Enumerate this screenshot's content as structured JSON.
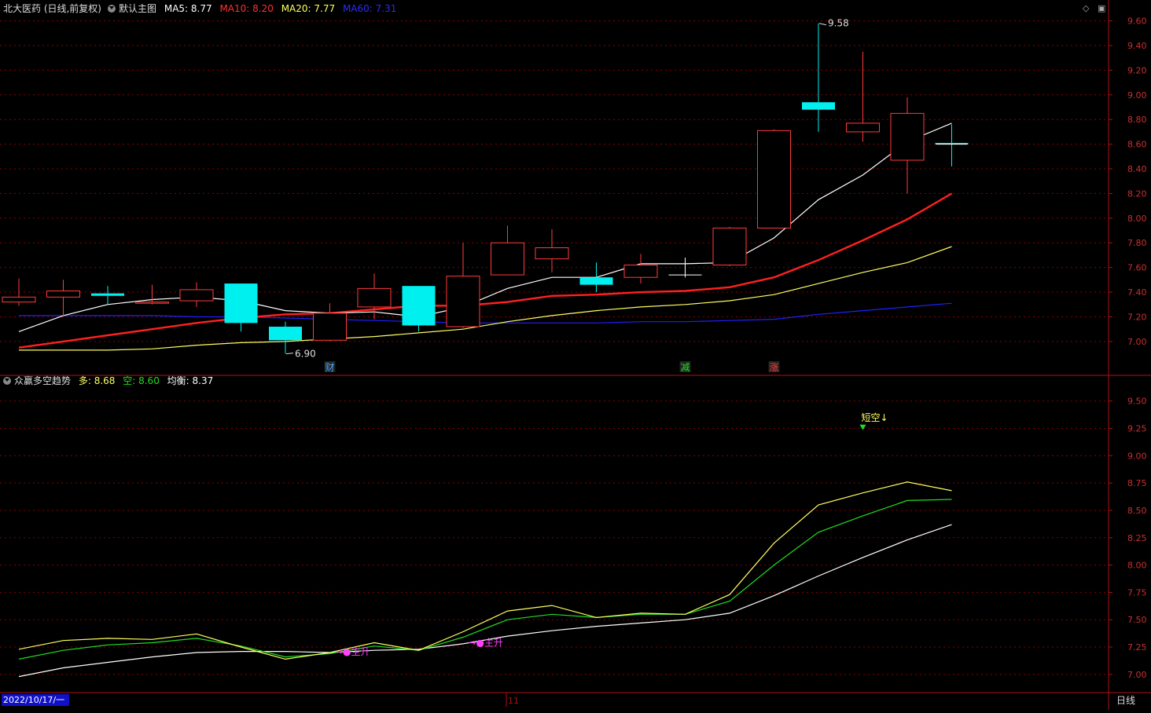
{
  "header_main": {
    "stock": "北大医药 (日线,前复权)",
    "main_chart": "默认主图",
    "ma5": "MA5: 8.77",
    "ma10": "MA10: 8.20",
    "ma20": "MA20: 7.77",
    "ma60": "MA60: 7.31"
  },
  "header_sub": {
    "indicator": "众赢多空趋势",
    "duo": "多: 8.68",
    "kong": "空: 8.60",
    "junheng": "均衡: 8.37"
  },
  "footer": {
    "date": "2022/10/17/一",
    "month_mark": "11",
    "period": "日线"
  },
  "colors": {
    "up": "#ff3b3b",
    "down": "#00f0f0",
    "ma5": "#ffffff",
    "ma10": "#ff2020",
    "ma20": "#ffff60",
    "ma60": "#2020ff",
    "duo": "#ffff60",
    "kong": "#20dd20",
    "junheng": "#ffffff",
    "grid": "#8b0000",
    "axis": "#b01010",
    "signal": "#ff40ff"
  },
  "chart_data": [
    {
      "type": "candlestick",
      "name": "main",
      "ylim": [
        6.84,
        9.68
      ],
      "yticks": [
        7.0,
        7.2,
        7.4,
        7.6,
        7.8,
        8.0,
        8.2,
        8.4,
        8.6,
        8.8,
        9.0,
        9.2,
        9.4,
        9.6
      ],
      "candles": [
        {
          "o": 7.32,
          "h": 7.51,
          "l": 7.29,
          "c": 7.36
        },
        {
          "o": 7.36,
          "h": 7.5,
          "l": 7.2,
          "c": 7.41
        },
        {
          "o": 7.39,
          "h": 7.45,
          "l": 7.3,
          "c": 7.37
        },
        {
          "o": 7.31,
          "h": 7.46,
          "l": 7.3,
          "c": 7.32
        },
        {
          "o": 7.33,
          "h": 7.48,
          "l": 7.28,
          "c": 7.42
        },
        {
          "o": 7.47,
          "h": 7.47,
          "l": 7.08,
          "c": 7.15
        },
        {
          "o": 7.12,
          "h": 7.16,
          "l": 6.9,
          "c": 7.01
        },
        {
          "o": 7.01,
          "h": 7.31,
          "l": 7.0,
          "c": 7.23
        },
        {
          "o": 7.28,
          "h": 7.55,
          "l": 7.18,
          "c": 7.43
        },
        {
          "o": 7.45,
          "h": 7.45,
          "l": 7.08,
          "c": 7.13
        },
        {
          "o": 7.12,
          "h": 7.8,
          "l": 7.11,
          "c": 7.53
        },
        {
          "o": 7.54,
          "h": 7.94,
          "l": 7.54,
          "c": 7.8
        },
        {
          "o": 7.67,
          "h": 7.91,
          "l": 7.56,
          "c": 7.76
        },
        {
          "o": 7.52,
          "h": 7.64,
          "l": 7.4,
          "c": 7.46
        },
        {
          "o": 7.52,
          "h": 7.71,
          "l": 7.47,
          "c": 7.62
        },
        {
          "o": 7.54,
          "h": 7.68,
          "l": 7.52,
          "c": 7.54
        },
        {
          "o": 7.62,
          "h": 7.93,
          "l": 7.61,
          "c": 7.92
        },
        {
          "o": 7.92,
          "h": 8.72,
          "l": 7.92,
          "c": 8.71
        },
        {
          "o": 8.94,
          "h": 9.58,
          "l": 8.7,
          "c": 8.88
        },
        {
          "o": 8.7,
          "h": 9.35,
          "l": 8.62,
          "c": 8.77
        },
        {
          "o": 8.47,
          "h": 8.98,
          "l": 8.2,
          "c": 8.85
        },
        {
          "o": 8.61,
          "h": 8.76,
          "l": 8.42,
          "c": 8.6
        }
      ],
      "ma5": [
        7.08,
        7.21,
        7.3,
        7.34,
        7.36,
        7.33,
        7.25,
        7.23,
        7.24,
        7.2,
        7.28,
        7.43,
        7.52,
        7.52,
        7.63,
        7.63,
        7.64,
        7.84,
        8.15,
        8.35,
        8.62,
        8.77
      ],
      "ma10": [
        6.95,
        7.0,
        7.05,
        7.1,
        7.15,
        7.19,
        7.22,
        7.23,
        7.26,
        7.29,
        7.29,
        7.32,
        7.37,
        7.38,
        7.4,
        7.41,
        7.44,
        7.52,
        7.66,
        7.82,
        7.99,
        8.2
      ],
      "ma20": [
        6.93,
        6.93,
        6.93,
        6.94,
        6.97,
        6.99,
        7.0,
        7.02,
        7.04,
        7.07,
        7.1,
        7.16,
        7.21,
        7.25,
        7.28,
        7.3,
        7.33,
        7.38,
        7.47,
        7.56,
        7.64,
        7.77
      ],
      "ma60": [
        7.21,
        7.21,
        7.21,
        7.21,
        7.2,
        7.2,
        7.19,
        7.18,
        7.17,
        7.16,
        7.15,
        7.15,
        7.15,
        7.15,
        7.16,
        7.16,
        7.17,
        7.18,
        7.22,
        7.25,
        7.28,
        7.31
      ],
      "annotations": [
        {
          "text": "9.58",
          "candle": 18,
          "price": 9.58
        },
        {
          "text": "6.90",
          "candle": 6,
          "price": 6.9
        }
      ],
      "markers": [
        {
          "text": "财",
          "candle": 7,
          "color": "#4aa8ff"
        },
        {
          "text": "减",
          "candle": 15,
          "color": "#20dd20"
        },
        {
          "text": "涨",
          "candle": 17,
          "color": "#ff3b3b"
        }
      ]
    },
    {
      "type": "line",
      "name": "众赢多空趋势",
      "ylim": [
        6.92,
        9.62
      ],
      "yticks": [
        7.0,
        7.25,
        7.5,
        7.75,
        8.0,
        8.25,
        8.5,
        8.75,
        9.0,
        9.25,
        9.5
      ],
      "series": [
        {
          "name": "多",
          "color": "#ffff60",
          "values": [
            7.23,
            7.31,
            7.33,
            7.32,
            7.37,
            7.25,
            7.14,
            7.2,
            7.29,
            7.22,
            7.39,
            7.58,
            7.63,
            7.52,
            7.56,
            7.55,
            7.73,
            8.2,
            8.55,
            8.66,
            8.76,
            8.68
          ]
        },
        {
          "name": "空",
          "color": "#20dd20",
          "values": [
            7.14,
            7.22,
            7.27,
            7.29,
            7.33,
            7.26,
            7.16,
            7.19,
            7.26,
            7.22,
            7.34,
            7.5,
            7.55,
            7.52,
            7.55,
            7.55,
            7.67,
            8.0,
            8.3,
            8.45,
            8.59,
            8.6
          ]
        },
        {
          "name": "均衡",
          "color": "#ffffff",
          "values": [
            6.98,
            7.06,
            7.11,
            7.16,
            7.2,
            7.21,
            7.21,
            7.2,
            7.22,
            7.23,
            7.28,
            7.35,
            7.4,
            7.44,
            7.47,
            7.5,
            7.56,
            7.72,
            7.9,
            8.07,
            8.23,
            8.37
          ]
        }
      ],
      "signals": [
        {
          "text": "→●主升",
          "candle": 8,
          "value": 7.18,
          "color": "#ff40ff"
        },
        {
          "text": "→●主升",
          "candle": 11,
          "value": 7.26,
          "color": "#ff40ff"
        },
        {
          "text": "短空↓",
          "candle": 19,
          "value": 9.32,
          "color": "#ffff60"
        }
      ]
    }
  ]
}
